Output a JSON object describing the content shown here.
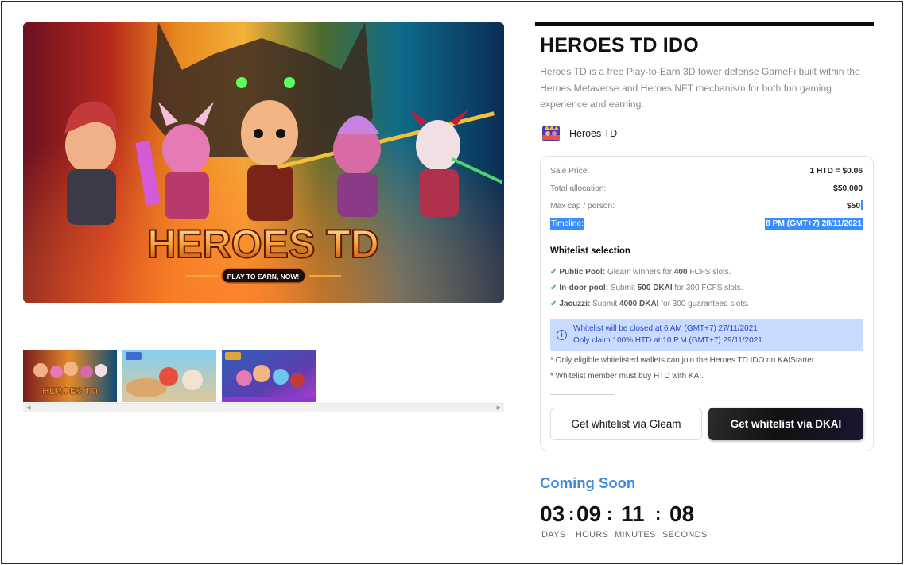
{
  "gallery": {
    "hero_logo_text": "HEROES TD",
    "hero_cta": "PLAY TO EARN, NOW!",
    "thumb_logo_text": "HEROES TD"
  },
  "project": {
    "title": "HEROES TD IDO",
    "description": "Heroes TD is a free Play-to-Earn 3D tower defense GameFi built within the Heroes Metaverse and Heroes NFT mechanism for both fun gaming experience and earning.",
    "name": "Heroes TD",
    "logo_icon": "heroes-td-logo-icon"
  },
  "sale": {
    "price_label": "Sale Price:",
    "price_value": "1 HTD = $0.06",
    "allocation_label": "Total allocation:",
    "allocation_value": "$50,000",
    "maxcap_label": "Max cap / person:",
    "maxcap_value": "$50",
    "timeline_label": "Timeline:",
    "timeline_value": "8 PM (GMT+7) 28/11/2021"
  },
  "whitelist": {
    "title": "Whitelist selection",
    "pools": [
      {
        "name": "Public Pool:",
        "pre": " Gleam winners for ",
        "strong": "400",
        "post": " FCFS slots."
      },
      {
        "name": "In-door pool:",
        "pre": " Submit ",
        "strong": "500 DKAI",
        "post": " for 300 FCFS slots."
      },
      {
        "name": "Jacuzzi:",
        "pre": " Submit ",
        "strong": "4000 DKAI",
        "post": " for 300 guaranteed slots."
      }
    ],
    "info_line1": "Whitelist will be closed at 6 AM (GMT+7) 27/11/2021",
    "info_line2": "Only claim 100% HTD at 10 P.M (GMT+7) 29/11/2021.",
    "note1": "* Only eligible whitelisted wallets can join the Heroes TD IDO on KAIStarter",
    "note2": "* Whitelist member must buy HTD with KAI.",
    "gleam_button": "Get whitelist via Gleam",
    "dkai_button": "Get whitelist via DKAI"
  },
  "status": {
    "coming_soon": "Coming Soon"
  },
  "countdown": {
    "days": "03",
    "hours": "09",
    "minutes": "11",
    "seconds": "08",
    "days_label": "DAYS",
    "hours_label": "HOURS",
    "minutes_label": "MINUTES",
    "seconds_label": "SECONDS",
    "separator": ":"
  },
  "colors": {
    "accent_blue": "#3d8bdc",
    "check_green": "#2fa84f",
    "info_bg": "#c9dcff",
    "selection": "#3a8dff"
  }
}
